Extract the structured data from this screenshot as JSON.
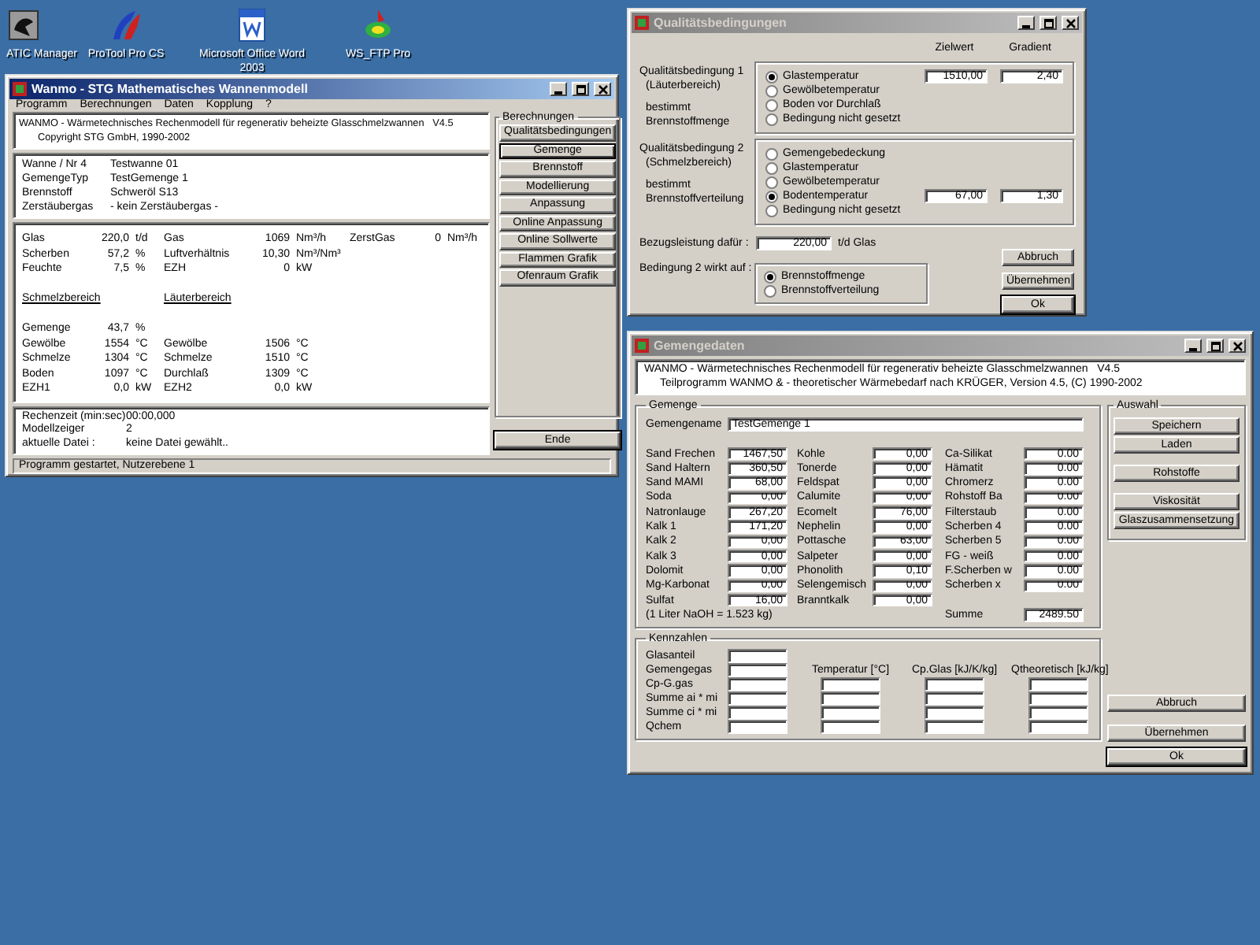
{
  "desktop_icons": [
    {
      "label": "ATIC Manager"
    },
    {
      "label": "ProTool Pro CS"
    },
    {
      "label": "Microsoft Office Word 2003"
    },
    {
      "label": "WS_FTP Pro"
    }
  ],
  "main_window": {
    "title": "Wanmo - STG Mathematisches Wannenmodell",
    "active": true,
    "menu": [
      "Programm",
      "Berechnungen",
      "Daten",
      "Kopplung",
      "?"
    ],
    "header_lines": [
      "WANMO - Wärmetechnisches Rechenmodell für regenerativ beheizte Glasschmelzwannen   V4.5",
      "Copyright STG GmbH, 1990-2002"
    ],
    "info": [
      {
        "label": "Wanne / Nr 4",
        "value": "Testwanne 01"
      },
      {
        "label": "GemengeTyp",
        "value": "TestGemenge 1"
      },
      {
        "label": "Brennstoff",
        "value": "Schweröl S13"
      },
      {
        "label": "Zerstäubergas",
        "value": "- kein Zerstäubergas -"
      }
    ],
    "process_rows": [
      [
        {
          "label": "Glas",
          "value": "220,0",
          "unit": "t/d"
        },
        {
          "label": "Gas",
          "value": "1069",
          "unit": "Nm³/h"
        },
        {
          "label": "ZerstGas",
          "value": "0",
          "unit": "Nm³/h"
        }
      ],
      [
        {
          "label": "Scherben",
          "value": "57,2",
          "unit": "%"
        },
        {
          "label": "Luftverhältnis",
          "value": "10,30",
          "unit": "Nm³/Nm³"
        }
      ],
      [
        {
          "label": "Feuchte",
          "value": "7,5",
          "unit": "%"
        },
        {
          "label": "EZH",
          "value": "0",
          "unit": "kW"
        }
      ]
    ],
    "section_headings": [
      "Schmelzbereich",
      "Läuterbereich"
    ],
    "zone_rows": [
      [
        {
          "label": "Gemenge",
          "value": "43,7",
          "unit": "%"
        }
      ],
      [
        {
          "label": "Gewölbe",
          "value": "1554",
          "unit": "°C"
        },
        {
          "label": "Gewölbe",
          "value": "1506",
          "unit": "°C"
        }
      ],
      [
        {
          "label": "Schmelze",
          "value": "1304",
          "unit": "°C"
        },
        {
          "label": "Schmelze",
          "value": "1510",
          "unit": "°C"
        }
      ],
      [
        {
          "label": "Boden",
          "value": "1097",
          "unit": "°C"
        },
        {
          "label": "Durchlaß",
          "value": "1309",
          "unit": "°C"
        }
      ],
      [
        {
          "label": "EZH1",
          "value": "0,0",
          "unit": "kW"
        },
        {
          "label": "EZH2",
          "value": "0,0",
          "unit": "kW"
        }
      ]
    ],
    "run_info": [
      {
        "label": "Rechenzeit (min:sec)",
        "value": "00:00,000"
      },
      {
        "label": "Modellzeiger",
        "value": "2"
      },
      {
        "label": "aktuelle Datei :",
        "value": "keine Datei gewählt.."
      }
    ],
    "calc_group": {
      "title": "Berechnungen",
      "buttons": [
        {
          "label": "Qualitätsbedingungen",
          "focused": false
        },
        {
          "label": "Gemenge",
          "focused": true
        },
        {
          "label": "Brennstoff",
          "focused": false
        },
        {
          "label": "Modellierung",
          "focused": false
        },
        {
          "label": "Anpassung",
          "focused": false
        },
        {
          "label": "Online Anpassung",
          "focused": false
        },
        {
          "label": "Online Sollwerte",
          "focused": false
        },
        {
          "label": "Flammen Grafik",
          "focused": false
        },
        {
          "label": "Ofenraum Grafik",
          "focused": false
        }
      ]
    },
    "exit_button": "Ende",
    "status_bar": "Programm gestartet, Nutzerebene 1"
  },
  "quality_window": {
    "title": "Qualitätsbedingungen",
    "active": false,
    "column_headers": [
      "Zielwert",
      "Gradient"
    ],
    "conditions": [
      {
        "label_lines": [
          "Qualitätsbedingung 1",
          "(Läuterbereich)",
          "bestimmt",
          "Brennstoffmenge"
        ],
        "target": "1510,00",
        "gradient": "2,40",
        "options": [
          {
            "label": "Glastemperatur",
            "selected": true
          },
          {
            "label": "Gewölbetemperatur",
            "selected": false
          },
          {
            "label": "Boden vor Durchlaß",
            "selected": false
          },
          {
            "label": "Bedingung nicht gesetzt",
            "selected": false
          }
        ]
      },
      {
        "label_lines": [
          "Qualitätsbedingung 2",
          "(Schmelzbereich)",
          "bestimmt",
          "Brennstoffverteilung"
        ],
        "target": "67,00",
        "gradient": "1,30",
        "options": [
          {
            "label": "Gemengebedeckung",
            "selected": false
          },
          {
            "label": "Glastemperatur",
            "selected": false
          },
          {
            "label": "Gewölbetemperatur",
            "selected": false
          },
          {
            "label": "Bodentemperatur",
            "selected": true
          },
          {
            "label": "Bedingung nicht gesetzt",
            "selected": false
          }
        ]
      }
    ],
    "reference": {
      "label": "Bezugsleistung dafür :",
      "value": "220,00",
      "unit": "t/d  Glas"
    },
    "applies_to": {
      "label": "Bedingung 2 wirkt auf :",
      "options": [
        {
          "label": "Brennstoffmenge",
          "selected": true
        },
        {
          "label": "Brennstoffverteilung",
          "selected": false
        }
      ]
    },
    "buttons": [
      {
        "label": "Abbruch",
        "default": false
      },
      {
        "label": "Übernehmen",
        "default": false
      },
      {
        "label": "Ok",
        "default": true
      }
    ]
  },
  "batch_window": {
    "title": "Gemengedaten",
    "active": false,
    "header_lines": [
      "WANMO - Wärmetechnisches Rechenmodell für regenerativ beheizte Glasschmelzwannen   V4.5",
      "Teilprogramm WANMO & - theoretischer Wärmebedarf nach KRÜGER, Version 4.5, (C) 1990-2002"
    ],
    "batch_group": {
      "title": "Gemenge",
      "name_label": "Gemengename",
      "name_value": "TestGemenge 1",
      "columns": [
        [
          {
            "label": "Sand Frechen",
            "value": "1467,50"
          },
          {
            "label": "Sand Haltern",
            "value": "360,50"
          },
          {
            "label": "Sand MAMI",
            "value": "68,00"
          },
          {
            "label": "Soda",
            "value": "0,00"
          },
          {
            "label": "Natronlauge",
            "value": "267,20"
          },
          {
            "label": "Kalk 1",
            "value": "171,20"
          },
          {
            "label": "Kalk 2",
            "value": "0,00"
          },
          {
            "label": "Kalk 3",
            "value": "0,00"
          },
          {
            "label": "Dolomit",
            "value": "0,00"
          },
          {
            "label": "Mg-Karbonat",
            "value": "0,00"
          },
          {
            "label": "Sulfat",
            "value": "16,00"
          }
        ],
        [
          {
            "label": "Kohle",
            "value": "0,00"
          },
          {
            "label": "Tonerde",
            "value": "0,00"
          },
          {
            "label": "Feldspat",
            "value": "0,00"
          },
          {
            "label": "Calumite",
            "value": "0,00"
          },
          {
            "label": "Ecomelt",
            "value": "76,00"
          },
          {
            "label": "Nephelin",
            "value": "0,00"
          },
          {
            "label": "Pottasche",
            "value": "63,00"
          },
          {
            "label": "Salpeter",
            "value": "0,00"
          },
          {
            "label": "Phonolith",
            "value": "0,10"
          },
          {
            "label": "Selengemisch",
            "value": "0,00"
          },
          {
            "label": "Branntkalk",
            "value": "0,00"
          }
        ],
        [
          {
            "label": "Ca-Silikat",
            "value": "0.00"
          },
          {
            "label": "Hämatit",
            "value": "0.00"
          },
          {
            "label": "Chromerz",
            "value": "0.00"
          },
          {
            "label": "Rohstoff Ba",
            "value": "0.00"
          },
          {
            "label": "Filterstaub",
            "value": "0.00"
          },
          {
            "label": "Scherben 4",
            "value": "0.00"
          },
          {
            "label": "Scherben 5",
            "value": "0.00"
          },
          {
            "label": "FG - weiß",
            "value": "0.00"
          },
          {
            "label": "F.Scherben w",
            "value": "0.00"
          },
          {
            "label": "Scherben x",
            "value": "0.00"
          }
        ]
      ],
      "note": "(1 Liter NaOH = 1.523 kg)",
      "sum_label": "Summe",
      "sum_value": "2489.50"
    },
    "select_group": {
      "title": "Auswahl",
      "buttons": [
        "Speichern",
        "Laden",
        "Rohstoffe",
        "Viskosität",
        "Glaszusammensetzung"
      ]
    },
    "key_figures": {
      "title": "Kennzahlen",
      "rows": [
        "Glasanteil",
        "Gemengegas",
        "Cp-G.gas",
        "Summe ai * mi",
        "Summe ci * mi",
        "Qchem"
      ],
      "columns": [
        "Temperatur [°C]",
        "Cp.Glas [kJ/K/kg]",
        "Qtheoretisch [kJ/kg]"
      ]
    },
    "buttons": [
      {
        "label": "Abbruch",
        "default": false
      },
      {
        "label": "Übernehmen",
        "default": false
      },
      {
        "label": "Ok",
        "default": true
      }
    ]
  }
}
